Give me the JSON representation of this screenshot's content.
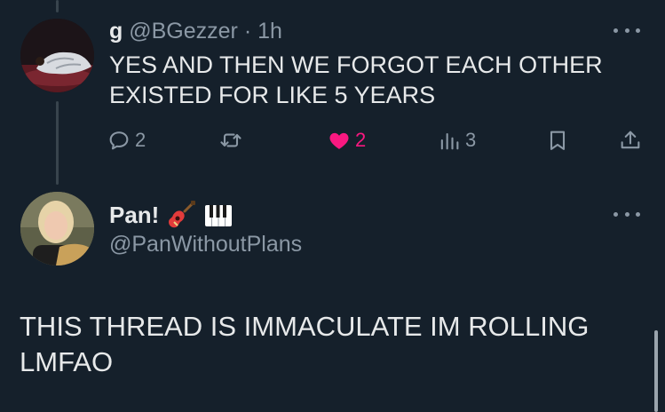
{
  "reply": {
    "name": "g",
    "handle": "@BGezzer",
    "separator": "·",
    "time": "1h",
    "text_line1": "YES AND THEN WE FORGOT EACH OTHER",
    "text_line2": "EXISTED FOR LIKE 5 YEARS",
    "actions": {
      "reply_count": "2",
      "retweet_count": "",
      "like_count": "2",
      "liked": true,
      "views_count": "3"
    }
  },
  "post": {
    "name": "Pan!",
    "name_emojis": [
      "guitar-emoji",
      "piano-keys-emoji"
    ],
    "handle": "@PanWithoutPlans",
    "text_line1": "THIS THREAD IS IMMACULATE IM ROLLING",
    "text_line2": "LMFAO"
  },
  "colors": {
    "background": "#15202b",
    "text": "#e7e9ea",
    "secondary": "#8b98a5",
    "like": "#f91880",
    "thread_line": "#38444d"
  },
  "icons": [
    "reply-icon",
    "retweet-icon",
    "heart-icon",
    "views-icon",
    "bookmark-icon",
    "share-icon",
    "more-icon"
  ]
}
